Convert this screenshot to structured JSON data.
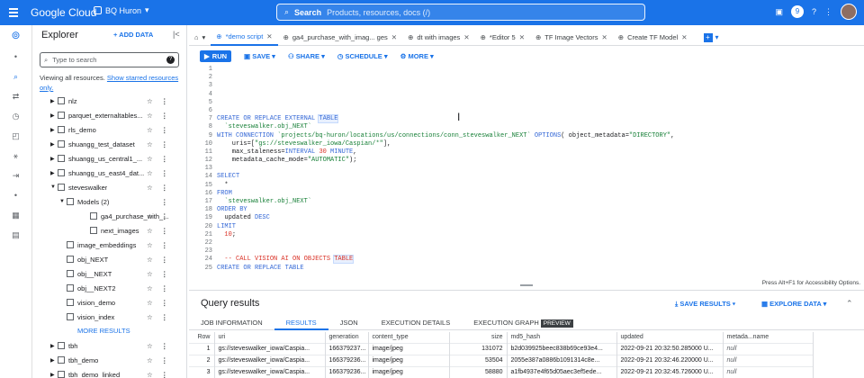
{
  "topbar": {
    "logo": "Google Cloud",
    "project": "BQ Huron",
    "search_label": "Search",
    "search_placeholder": "Products, resources, docs (/)",
    "notification_count": "9"
  },
  "explorer": {
    "title": "Explorer",
    "add_data": "+ ADD DATA",
    "search_placeholder": "Type to search",
    "note": "Viewing all resources.",
    "note_link": "Show starred resources only.",
    "items": [
      {
        "name": "nlz",
        "indent": 0,
        "caret": "▶",
        "kebab": true
      },
      {
        "name": "parquet_externaltables...",
        "indent": 0,
        "caret": "▶",
        "kebab": true
      },
      {
        "name": "rls_demo",
        "indent": 0,
        "caret": "▶",
        "kebab": true
      },
      {
        "name": "shuangg_test_dataset",
        "indent": 0,
        "caret": "▶",
        "kebab": true
      },
      {
        "name": "shuangg_us_central1_...",
        "indent": 0,
        "caret": "▶",
        "kebab": true
      },
      {
        "name": "shuangg_us_east4_dat...",
        "indent": 0,
        "caret": "▶",
        "kebab": true
      },
      {
        "name": "steveswalker",
        "indent": 0,
        "caret": "▼",
        "kebab": true
      },
      {
        "name": "Models (2)",
        "indent": 1,
        "caret": "▼",
        "kebab": false
      },
      {
        "name": "ga4_purchase_with_...",
        "indent": 2,
        "caret": "",
        "kebab": true
      },
      {
        "name": "next_images",
        "indent": 2,
        "caret": "",
        "kebab": true
      },
      {
        "name": "image_embeddings",
        "indent": 1,
        "caret": "",
        "kebab": true
      },
      {
        "name": "obj_NEXT",
        "indent": 1,
        "caret": "",
        "kebab": true
      },
      {
        "name": "obj__NEXT",
        "indent": 1,
        "caret": "",
        "kebab": true
      },
      {
        "name": "obj__NEXT2",
        "indent": 1,
        "caret": "",
        "kebab": true
      },
      {
        "name": "vision_demo",
        "indent": 1,
        "caret": "",
        "kebab": true
      },
      {
        "name": "vision_index",
        "indent": 1,
        "caret": "",
        "kebab": true
      }
    ],
    "more_results": "MORE RESULTS",
    "items2": [
      {
        "name": "tbh",
        "caret": "▶"
      },
      {
        "name": "tbh_demo",
        "caret": "▶"
      },
      {
        "name": "tbh_demo_linked",
        "caret": "▶"
      },
      {
        "name": "tbh_usc1",
        "caret": "▶"
      }
    ]
  },
  "tabs": [
    {
      "label": "*demo script",
      "active": true
    },
    {
      "label": "ga4_purchase_with_imag... ges",
      "active": false
    },
    {
      "label": "dt with images",
      "active": false
    },
    {
      "label": "*Editor 5",
      "active": false
    },
    {
      "label": "TF Image Vectors",
      "active": false
    },
    {
      "label": "Create TF Model",
      "active": false
    }
  ],
  "toolbar": {
    "run": "RUN",
    "save": "SAVE",
    "share": "SHARE",
    "schedule": "SCHEDULE",
    "more": "MORE"
  },
  "editor": {
    "lines": [
      {
        "n": "1",
        "html": ""
      },
      {
        "n": "2",
        "html": ""
      },
      {
        "n": "3",
        "html": ""
      },
      {
        "n": "4",
        "html": ""
      },
      {
        "n": "5",
        "html": ""
      },
      {
        "n": "6",
        "html": ""
      },
      {
        "n": "7",
        "html": "<span class='kw'>CREATE OR REPLACE EXTERNAL</span> <span class='kw hl'>TABLE</span>"
      },
      {
        "n": "8",
        "html": "  <span class='str'>`steveswalker.obj_NEXT`</span>"
      },
      {
        "n": "9",
        "html": "<span class='kw'>WITH CONNECTION</span> <span class='str'>`projects/bq-huron/locations/us/connections/conn_steveswalker_NEXT`</span> <span class='kw'>OPTIONS</span>( object_metadata=<span class='str'>\"DIRECTORY\"</span>,"
      },
      {
        "n": "10",
        "html": "    uris=[<span class='str'>\"gs://steveswalker_iowa/Caspian/*\"</span>],"
      },
      {
        "n": "11",
        "html": "    max_staleness=<span class='kw'>INTERVAL</span> <span class='num'>30</span> <span class='kw'>MINUTE</span>,"
      },
      {
        "n": "12",
        "html": "    metadata_cache_mode=<span class='str'>\"AUTOMATIC\"</span>);"
      },
      {
        "n": "13",
        "html": ""
      },
      {
        "n": "14",
        "html": "<span class='kw'>SELECT</span>"
      },
      {
        "n": "15",
        "html": "  *"
      },
      {
        "n": "16",
        "html": "<span class='kw'>FROM</span>"
      },
      {
        "n": "17",
        "html": "  <span class='str'>`steveswalker.obj_NEXT`</span>"
      },
      {
        "n": "18",
        "html": "<span class='kw'>ORDER BY</span>"
      },
      {
        "n": "19",
        "html": "  updated <span class='kw'>DESC</span>"
      },
      {
        "n": "20",
        "html": "<span class='kw'>LIMIT</span>"
      },
      {
        "n": "21",
        "html": "  <span class='num'>10</span>;"
      },
      {
        "n": "22",
        "html": ""
      },
      {
        "n": "23",
        "html": ""
      },
      {
        "n": "24",
        "html": "  <span class='cmt'>-- CALL VISION AI ON OBJECTS</span> <span class='cmt hl'>TABLE</span>"
      },
      {
        "n": "25",
        "html": "<span class='kw'>CREATE OR REPLACE TABLE</span>"
      }
    ]
  },
  "accessibility_hint": "Press Alt+F1 for Accessibility Options.",
  "results": {
    "title": "Query results",
    "save": "SAVE RESULTS",
    "explore": "EXPLORE DATA",
    "tabs": [
      "JOB INFORMATION",
      "RESULTS",
      "JSON",
      "EXECUTION DETAILS",
      "EXECUTION GRAPH"
    ],
    "active_tab": "RESULTS",
    "preview": "PREVIEW",
    "columns": [
      "Row",
      "uri",
      "generation",
      "content_type",
      "size",
      "md5_hash",
      "updated",
      "metada...name"
    ],
    "rows": [
      [
        "1",
        "gs://steveswalker_iowa/Caspia...",
        "166379237...",
        "image/jpeg",
        "131072",
        "b2d039925beec838b69ce93e4...",
        "2022-09-21 20:32:50.285000 U...",
        "null"
      ],
      [
        "2",
        "gs://steveswalker_iowa/Caspia...",
        "166379236...",
        "image/jpeg",
        "53504",
        "2055e387a0886b1091314c8e...",
        "2022-09-21 20:32:46.220000 U...",
        "null"
      ],
      [
        "3",
        "gs://steveswalker_iowa/Caspia...",
        "166379236...",
        "image/jpeg",
        "58880",
        "a1fb4937e4f65d05aec3ef5ede...",
        "2022-09-21 20:32:45.726000 U...",
        "null"
      ]
    ]
  }
}
